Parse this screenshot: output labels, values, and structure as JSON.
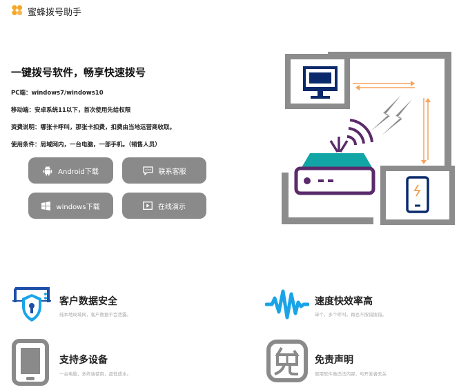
{
  "app": {
    "name": "蜜蜂拨号助手",
    "accent": "#f5a623",
    "icon_name": "bee-logo-icon"
  },
  "hero": {
    "title": "一键拨号软件，畅享快速拨号",
    "info": [
      "PC端：windows7/windows10",
      "移动端：安卓系统11以下，首次使用先给权限",
      "资费说明：哪张卡呼叫，那张卡扣费，扣费由当地运营商收取。",
      "使用条件：局域网内，一台电脑，一部手机。（销售人员）"
    ]
  },
  "buttons": {
    "android": {
      "label": "Android下载",
      "icon": "android-icon"
    },
    "service": {
      "label": "联系客服",
      "icon": "chat-icon"
    },
    "windows": {
      "label": "windows下载",
      "icon": "windows-icon"
    },
    "demo": {
      "label": "在线演示",
      "icon": "play-icon"
    }
  },
  "illustration": {
    "icons": [
      "monitor-icon",
      "router-icon",
      "phone-icon",
      "arrows-icon"
    ],
    "colors": {
      "gray": "#8c8c8c",
      "navy": "#0a2a6b",
      "teal": "#12a5a5",
      "purple": "#5a2a6a",
      "orange": "#f5a35a"
    }
  },
  "features": [
    {
      "title": "客户数据安全",
      "desc": "纯本地局域网，客户数据不会泄露。",
      "icon": "security-lock-icon"
    },
    {
      "title": "速度快效率高",
      "desc": "单个，多个呼叫，再也不按错拨错。",
      "icon": "sound-wave-icon"
    },
    {
      "title": "支持多设备",
      "desc": "一台电脑，多终端使用，超低成本。",
      "icon": "mobile-device-icon"
    },
    {
      "title": "免责声明",
      "desc": "使用软件做违法内容，与开发者无关",
      "icon": "disclaimer-icon"
    }
  ]
}
